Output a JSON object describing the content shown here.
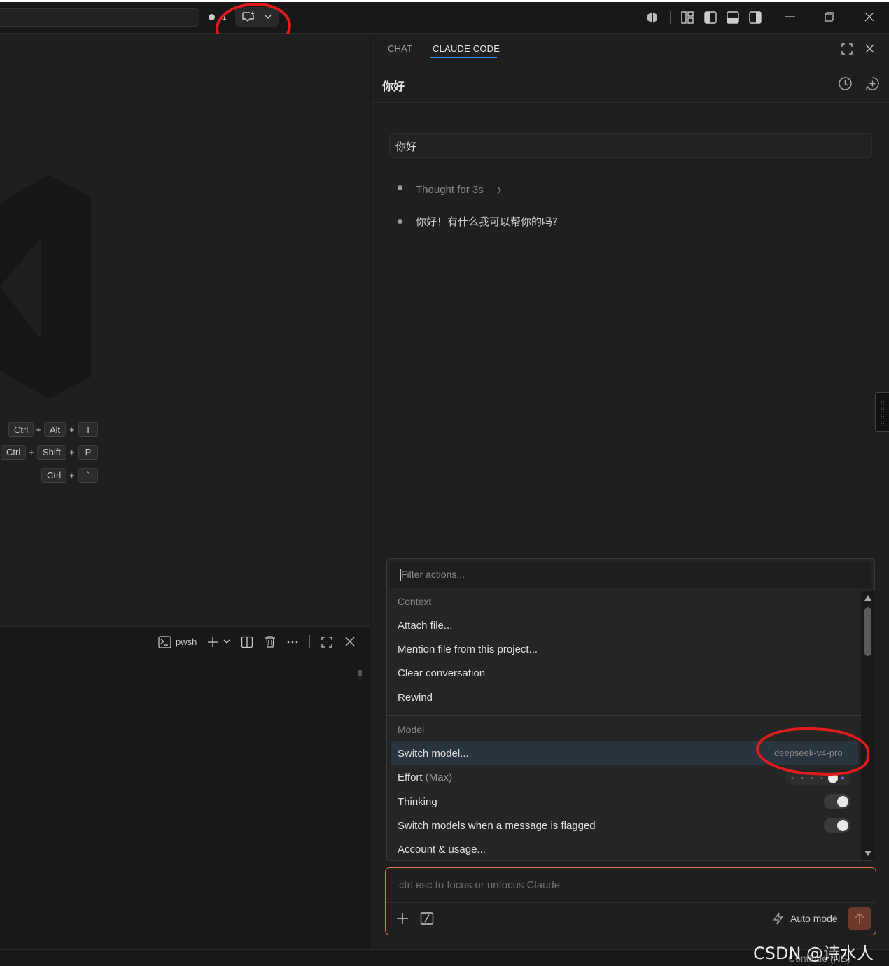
{
  "titlebar": {
    "dirty_count": "1"
  },
  "shortcuts": [
    {
      "keys": [
        "Ctrl",
        "Alt",
        "I"
      ]
    },
    {
      "keys": [
        "Ctrl",
        "Shift",
        "P"
      ]
    },
    {
      "keys": [
        "Ctrl",
        "`"
      ]
    }
  ],
  "panel": {
    "terminal_label": "pwsh"
  },
  "sidebar": {
    "tabs": [
      {
        "label": "CHAT",
        "active": false
      },
      {
        "label": "CLAUDE CODE",
        "active": true
      }
    ],
    "conversation_title": "你好",
    "messages": {
      "user": "你好",
      "thought": "Thought for 3s",
      "reply": "你好！有什么我可以帮你的吗?"
    }
  },
  "actions_menu": {
    "filter_placeholder": "Filter actions...",
    "sections": [
      {
        "title": "Context",
        "items": [
          "Attach file...",
          "Mention file from this project...",
          "Clear conversation",
          "Rewind"
        ]
      },
      {
        "title": "Model",
        "items": [
          {
            "label": "Switch model...",
            "value": "deepseek-v4-pro",
            "highlighted": true
          },
          {
            "label": "Effort",
            "suffix": "(Max)"
          },
          {
            "label": "Thinking",
            "toggle": true
          },
          {
            "label": "Switch models when a message is flagged",
            "toggle": true
          },
          {
            "label": "Account & usage..."
          }
        ]
      }
    ]
  },
  "input": {
    "placeholder": "ctrl esc to focus or unfocus Claude",
    "mode_label": "Auto mode"
  },
  "statusbar": {
    "continue_text": "Continue (NE)"
  },
  "watermark": "CSDN @诗水人间",
  "colors": {
    "accent_blue": "#3794ff",
    "input_border": "#d9765a",
    "send_button": "#6b3a2c",
    "annotation_red": "#e31b1b"
  }
}
